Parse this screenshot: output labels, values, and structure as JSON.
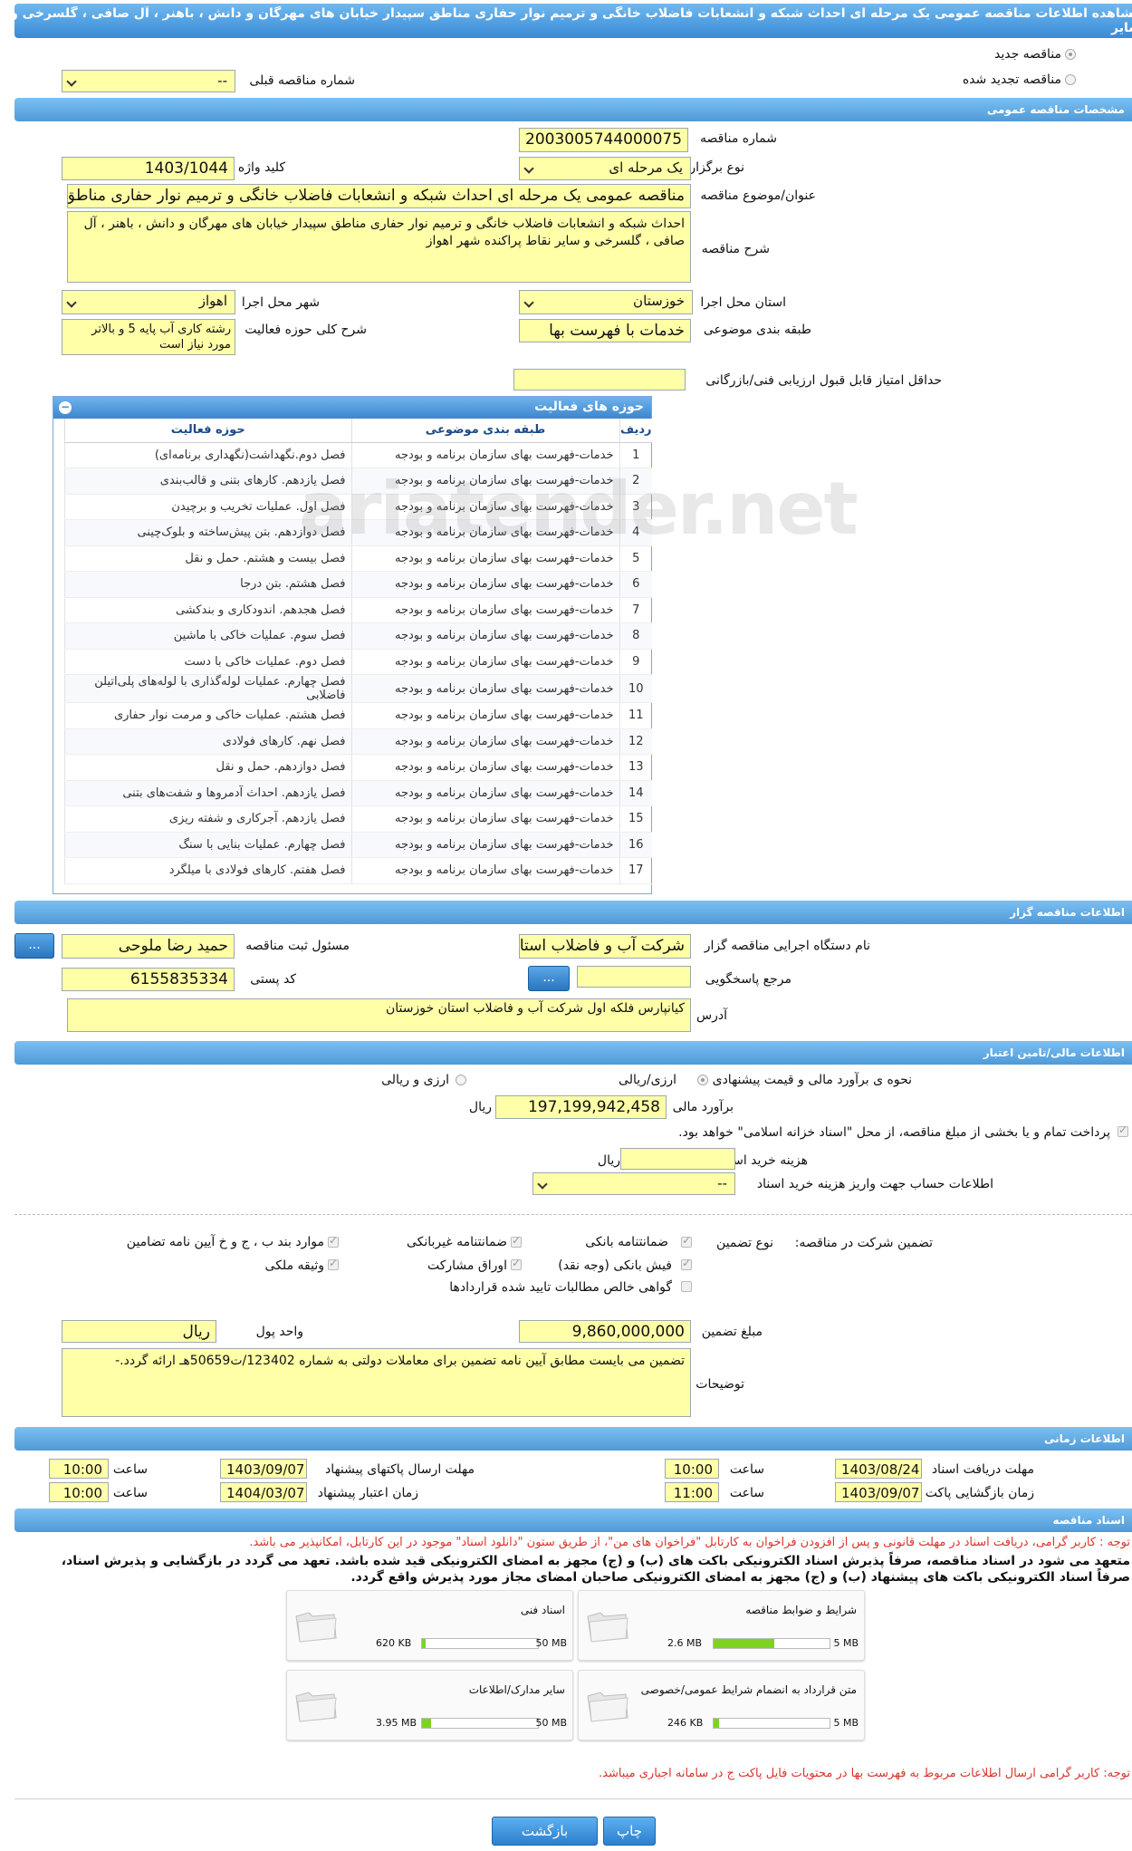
{
  "header": {
    "title": "مشاهده اطلاعات مناقصه عمومی یک مرحله ای احداث شبکه و انشعابات فاضلاب خانگی و ترمیم نوار حفاری مناطق سپیدار خیابان های مهرگان و دانش ، باهنر ، آل صافی ، گلسرخی و سایر"
  },
  "tender_type": {
    "new_label": "مناقصه جدید",
    "renewed_label": "مناقصه تجدید شده",
    "prev_number_label": "شماره مناقصه قبلی",
    "prev_number_value": "--"
  },
  "sections": {
    "general": "مشخصات مناقصه عمومی",
    "organizer": "اطلاعات مناقصه گزار",
    "financial": "اطلاعات مالی/تامین اعتبار",
    "timing": "اطلاعات زمانی",
    "documents": "اسناد مناقصه"
  },
  "general": {
    "tender_number_label": "شماره مناقصه",
    "tender_number": "2003005744000075",
    "holding_type_label": "نوع برگزاری",
    "holding_type": "یک مرحله ای",
    "keyword_label": "کلید واژه",
    "keyword": "1403/1044",
    "subject_label": "عنوان/موضوع مناقصه",
    "subject": "مناقصه عمومی یک مرحله ای احداث شبکه و انشعابات فاضلاب خانگی و ترمیم نوار حفاری مناطق سپیدار",
    "description_label": "شرح مناقصه",
    "description": "احداث شبکه و انشعابات فاضلاب خانگی و ترمیم نوار حفاری مناطق سپیدار خیابان های مهرگان و دانش ، باهنر ، آل صافی ، گلسرخی و سایر نقاط پراکنده شهر اهواز",
    "province_label": "استان محل اجرا",
    "province": "خوزستان",
    "city_label": "شهر محل اجرا",
    "city": "اهواز",
    "category_label": "طبقه بندی موضوعی",
    "category": "خدمات با فهرست بها",
    "activity_desc_label": "شرح کلی حوزه فعالیت",
    "activity_desc": "رشته کاری آب پایه 5 و بالاتر مورد نیاز است",
    "min_score_label": "حداقل امتیاز قابل قبول ارزیابی فنی/بازرگانی",
    "min_score": ""
  },
  "activity_grid": {
    "title": "حوزه های فعالیت",
    "columns": [
      "ردیف",
      "طبقه بندی موضوعی",
      "حوزه فعالیت"
    ],
    "rows": [
      [
        "1",
        "خدمات-فهرست بهای سازمان برنامه و بودجه",
        "فصل دوم.نگهداشت(نگهداری برنامه‌ای)"
      ],
      [
        "2",
        "خدمات-فهرست بهای سازمان برنامه و بودجه",
        "فصل یازدهم. کارهای بتنی و قالب‌بندی"
      ],
      [
        "3",
        "خدمات-فهرست بهای سازمان برنامه و بودجه",
        "فصل اول. عملیات تخریب و برچیدن"
      ],
      [
        "4",
        "خدمات-فهرست بهای سازمان برنامه و بودجه",
        "فصل دوازدهم. بتن پیش‌ساخته و بلوک‌چینی"
      ],
      [
        "5",
        "خدمات-فهرست بهای سازمان برنامه و بودجه",
        "فصل بیست و هشتم. حمل و نقل"
      ],
      [
        "6",
        "خدمات-فهرست بهای سازمان برنامه و بودجه",
        "فصل هشتم. بتن درجا"
      ],
      [
        "7",
        "خدمات-فهرست بهای سازمان برنامه و بودجه",
        "فصل هجدهم. اندودکاری و بندکشی"
      ],
      [
        "8",
        "خدمات-فهرست بهای سازمان برنامه و بودجه",
        "فصل سوم. عملیات خاکی با ماشین"
      ],
      [
        "9",
        "خدمات-فهرست بهای سازمان برنامه و بودجه",
        "فصل دوم. عملیات خاکی با دست"
      ],
      [
        "10",
        "خدمات-فهرست بهای سازمان برنامه و بودجه",
        "فصل چهارم. عملیات لوله‌گذاری با لوله‌های پلی‌اتیلن فاضلابی"
      ],
      [
        "11",
        "خدمات-فهرست بهای سازمان برنامه و بودجه",
        "فصل هشتم. عملیات خاکی و مرمت نوار حفاری"
      ],
      [
        "12",
        "خدمات-فهرست بهای سازمان برنامه و بودجه",
        "فصل نهم. کارهای فولادی"
      ],
      [
        "13",
        "خدمات-فهرست بهای سازمان برنامه و بودجه",
        "فصل دوازدهم. حمل و نقل"
      ],
      [
        "14",
        "خدمات-فهرست بهای سازمان برنامه و بودجه",
        "فصل یازدهم. احداث آدمروها و شفت‌های بتنی"
      ],
      [
        "15",
        "خدمات-فهرست بهای سازمان برنامه و بودجه",
        "فصل یازدهم. آجرکاری و شفته ریزی"
      ],
      [
        "16",
        "خدمات-فهرست بهای سازمان برنامه و بودجه",
        "فصل چهارم. عملیات بنایی با سنگ"
      ],
      [
        "17",
        "خدمات-فهرست بهای سازمان برنامه و بودجه",
        "فصل هفتم. کارهای فولادی با میلگرد"
      ]
    ]
  },
  "watermark": "ariatender.net",
  "organizer": {
    "org_label": "نام دستگاه اجرایی مناقصه گزار",
    "org": "شرکت آب و فاضلاب استان",
    "registrar_label": "مسئول ثبت مناقصه",
    "registrar": "حمید رضا ملوحی",
    "reference_label": "مرجع پاسخگویی",
    "reference": "",
    "postal_label": "کد پستی",
    "postal": "6155835334",
    "address_label": "آدرس",
    "address": "کیانپارس فلکه اول شرکت آب و فاضلاب استان خوزستان",
    "dots": "..."
  },
  "financial": {
    "estimate_method_label": "نحوه ی برآورد مالی و قیمت پیشنهادی",
    "opt_rial": "ارزی/ریالی",
    "opt_currency": "ارزی و ریالی",
    "estimate_label": "برآورد مالی",
    "estimate": "197,199,942,458",
    "rial": "ریال",
    "treasury_note": "پرداخت تمام و یا بخشی از مبلغ مناقصه، از محل \"اسناد خزانه اسلامی\" خواهد بود.",
    "doc_fee_label": "هزینه خرید اسناد",
    "doc_fee": "",
    "account_label": "اطلاعات حساب جهت واریز هزینه خرید اسناد",
    "account_value": "--",
    "guarantee_label": "تضمین شرکت در مناقصه:",
    "guarantee_type_label": "نوع تضمین",
    "g_bank": "ضمانتنامه بانکی",
    "g_nonbank": "ضمانتنامه غیربانکی",
    "g_clauses": "موارد بند ب ، ج و خ آیین نامه تضامین",
    "g_cash": "فیش بانکی (وجه نقد)",
    "g_bonds": "اوراق مشارکت",
    "g_property": "وثیقه ملکی",
    "g_claims": "گواهی خالص مطالبات تایید شده قراردادها",
    "amount_label": "مبلغ تضمین",
    "amount": "9,860,000,000",
    "currency_label": "واحد پول",
    "currency": "ریال",
    "notes_label": "توضیحات",
    "notes": "تضمین می بایست مطابق آیین نامه تضمین برای معاملات دولتی به شماره 123402/ت50659هـ ارائه گردد.-"
  },
  "timing": {
    "doc_deadline_label": "مهلت دریافت اسناد",
    "doc_deadline_date": "1403/08/24",
    "doc_deadline_time": "10:00",
    "send_deadline_label": "مهلت ارسال پاکتهای پیشنهاد",
    "send_deadline_date": "1403/09/07",
    "send_deadline_time": "10:00",
    "opening_label": "زمان بازگشایی پاکت ها",
    "opening_date": "1403/09/07",
    "opening_time": "11:00",
    "validity_label": "زمان اعتبار پیشنهاد",
    "validity_date": "1404/03/07",
    "validity_time": "10:00",
    "time_label": "ساعت"
  },
  "documents": {
    "note1": "توجه : کاربر گرامی، دریافت اسناد در مهلت قانونی و پس از افزودن فراخوان به کارتابل \"فراخوان های من\"، از طریق ستون \"دانلود اسناد\" موجود در این کارتابل، امکانپذیر می باشد.",
    "bold1": "متعهد می شود در اسناد مناقصه، صرفاً پذیرش اسناد الکترونیکی باکت های (ب) و (ج) مجهز به امضای الکترونیکی قید شده باشد. تعهد می گردد در بازگشایی و پذیرش اسناد،",
    "bold2": "صرفاً اسناد الکترونیکی باکت های پیشنهاد (ب) و (ج) مجهز به امضای الکترونیکی صاحبان امضای مجاز مورد پذیرش واقع گردد.",
    "files": [
      {
        "name": "شرایط و ضوابط مناقصه",
        "current": "2.6 MB",
        "max": "5 MB",
        "ratio": 0.52
      },
      {
        "name": "اسناد فنی",
        "current": "620 KB",
        "max": "50 MB",
        "ratio": 0.012
      },
      {
        "name": "متن قرارداد به انضمام شرایط عمومی/خصوصی",
        "current": "246 KB",
        "max": "5 MB",
        "ratio": 0.05
      },
      {
        "name": "سایر مدارک/اطلاعات",
        "current": "3.95 MB",
        "max": "50 MB",
        "ratio": 0.08
      }
    ],
    "note2": "توجه: کاربر گرامی ارسال اطلاعات مربوط به فهرست بها در محتویات فایل پاکت ج در سامانه اجباری میباشد."
  },
  "buttons": {
    "print": "چاپ",
    "back": "بازگشت"
  }
}
